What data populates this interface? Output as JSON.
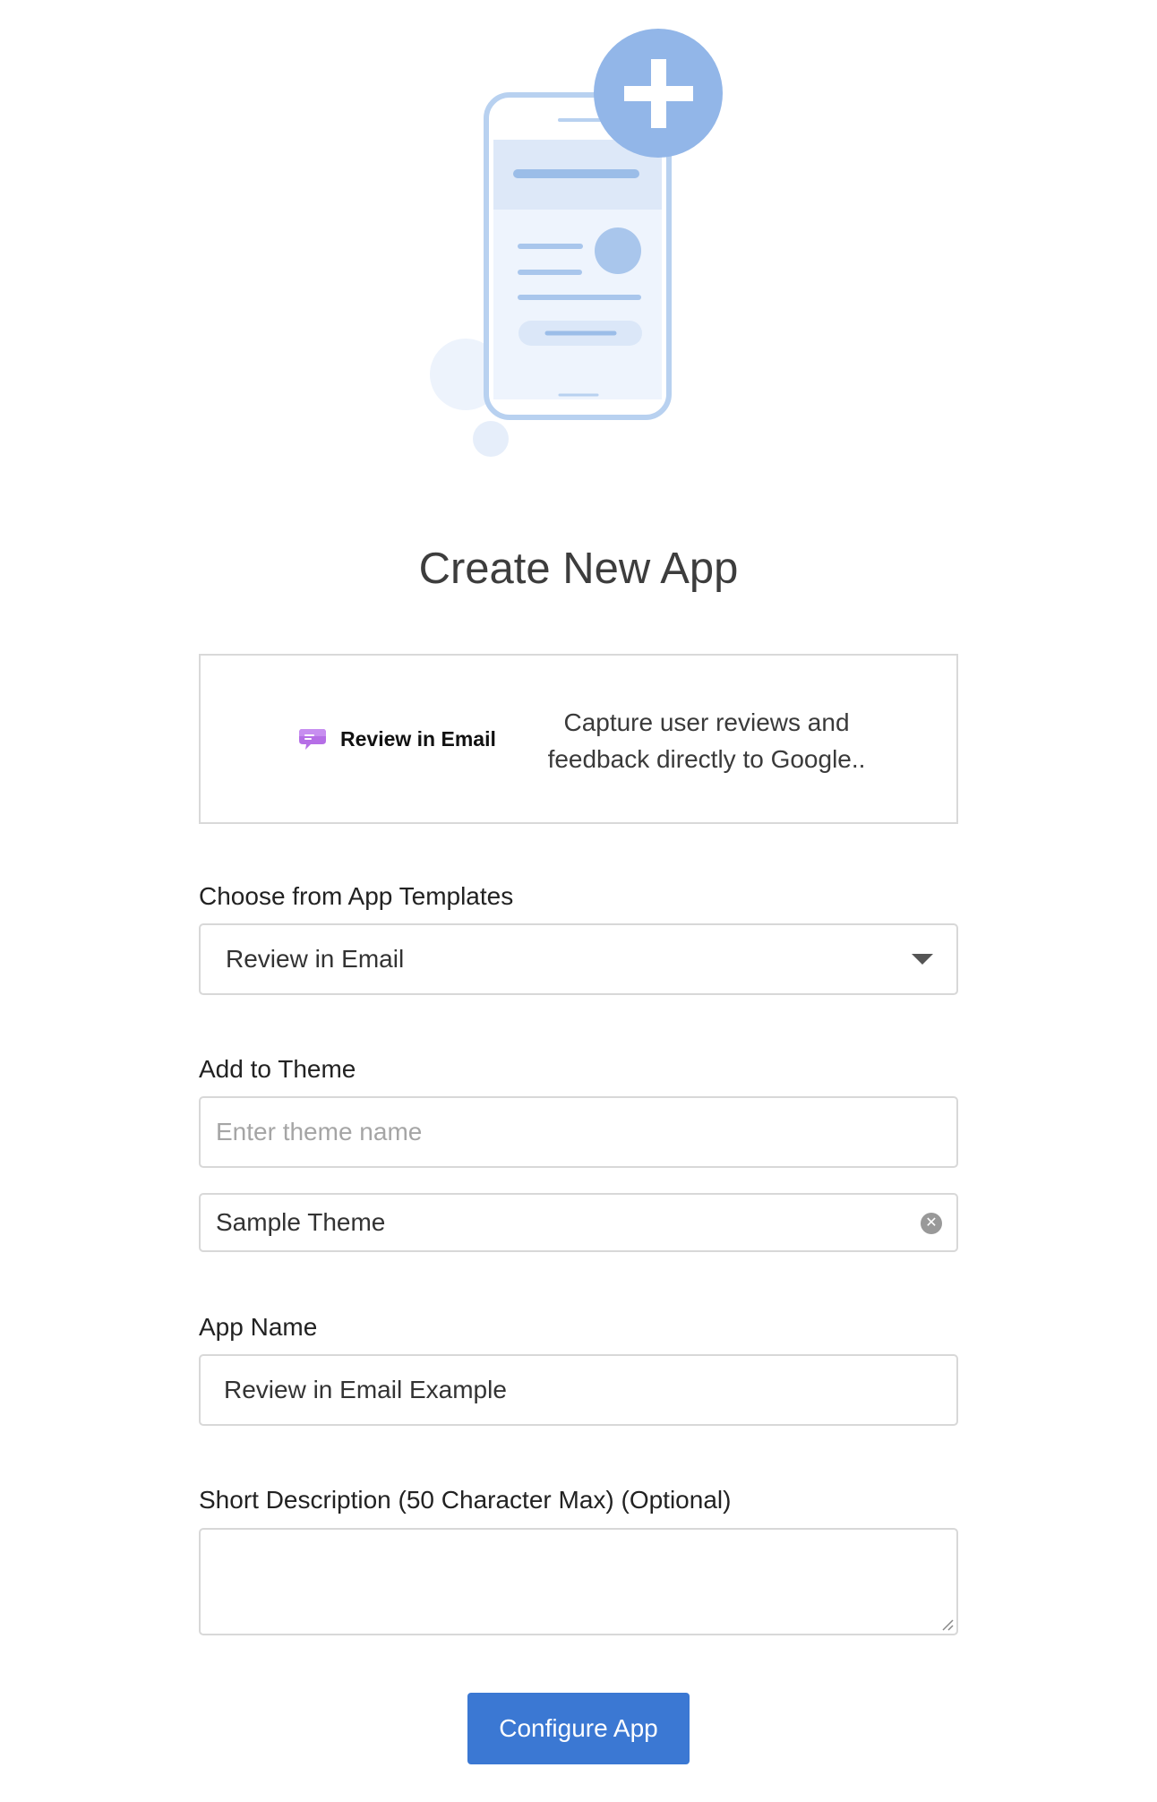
{
  "page": {
    "title": "Create New App"
  },
  "hero": {
    "icon": "phone-with-plus-illustration"
  },
  "template_card": {
    "name": "Review in Email",
    "description": "Capture user reviews and feedback directly to Google..",
    "icon": "chat-bubble-icon",
    "icon_color": "#b56ee6"
  },
  "form": {
    "template": {
      "label": "Choose from App Templates",
      "selected": "Review in Email"
    },
    "theme": {
      "label": "Add to Theme",
      "placeholder": "Enter theme name",
      "value": "",
      "selected_theme": "Sample Theme"
    },
    "app_name": {
      "label": "App Name",
      "value": "Review in Email Example"
    },
    "short_description": {
      "label": "Short Description (50 Character Max) (Optional)",
      "value": ""
    },
    "submit_label": "Configure App"
  },
  "colors": {
    "accent": "#3b78d3",
    "illustration": "#9bbde8"
  }
}
